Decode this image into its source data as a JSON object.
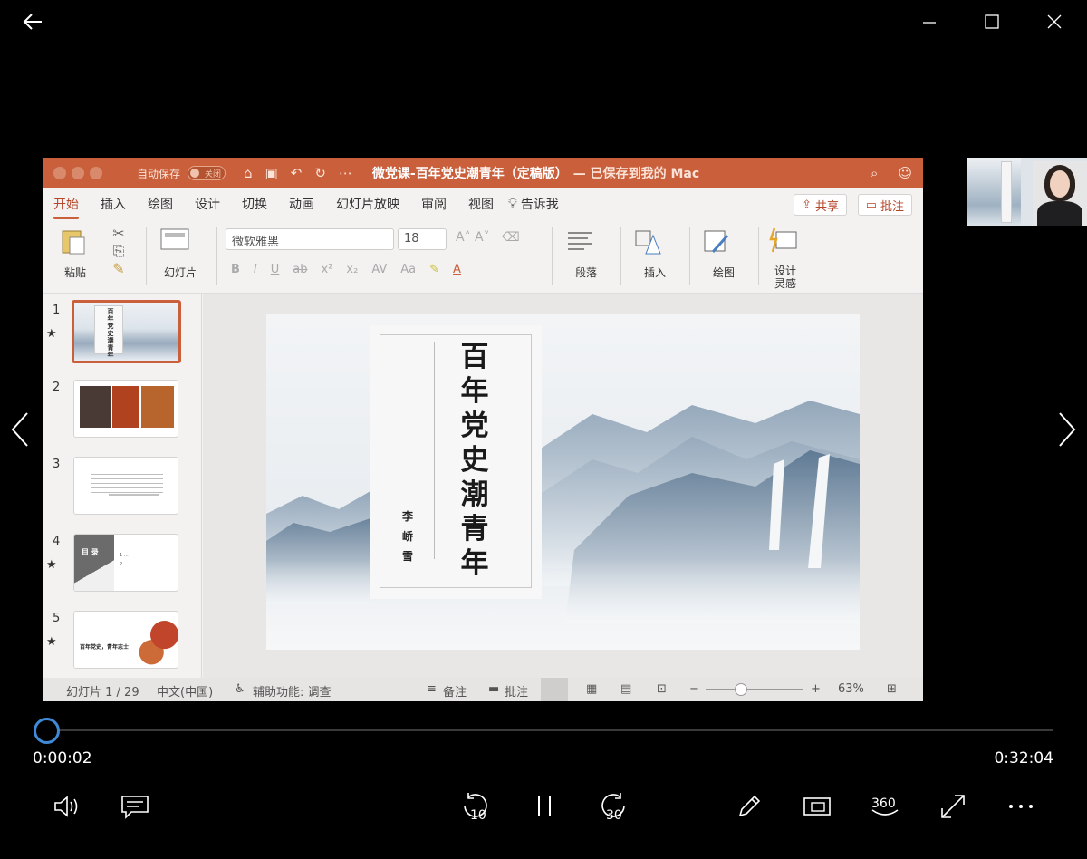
{
  "window": {
    "back_icon": "arrow-left-icon",
    "minimize_icon": "minimize-icon",
    "maximize_icon": "maximize-icon",
    "close_icon": "close-icon"
  },
  "ppt": {
    "autosave_label": "自动保存",
    "autosave_state": "关闭",
    "doc_title": "微党课-百年党史潮青年（定稿版）",
    "saved_note": "— 已保存到我的 Mac",
    "tabs": [
      "开始",
      "插入",
      "绘图",
      "设计",
      "切换",
      "动画",
      "幻灯片放映",
      "审阅",
      "视图"
    ],
    "tell_me": "告诉我",
    "share_label": "共享",
    "comment_label": "批注",
    "ribbon": {
      "paste": "粘贴",
      "slide": "幻灯片",
      "font_name": "微软雅黑",
      "font_size": "18",
      "paragraph": "段落",
      "insert": "插入",
      "draw": "绘图",
      "designer_1": "设计",
      "designer_2": "灵感",
      "fmt_buttons": [
        "B",
        "I",
        "U",
        "ab",
        "x²",
        "x₂",
        "AV",
        "Aa"
      ]
    },
    "thumb_numbers": [
      "1",
      "2",
      "3",
      "4",
      "5"
    ],
    "thumbs": {
      "t1_title": "百年党史潮青年",
      "t4_label": "目 录",
      "t4_item1": "1  …",
      "t4_item2": "2  …",
      "t5_title": "百年党史，青年志士"
    },
    "slide": {
      "title_chars": [
        "百",
        "年",
        "党",
        "史",
        "潮",
        "青",
        "年"
      ],
      "author_chars": [
        "李",
        "峤",
        "雪"
      ]
    },
    "status": {
      "slide_info": "幻灯片 1 / 29",
      "language": "中文(中国)",
      "accessibility": "辅助功能: 调查",
      "notes": "备注",
      "comments": "批注",
      "zoom": "63%",
      "zoom_level": 0.3
    }
  },
  "player": {
    "current_time": "0:00:02",
    "total_time": "0:32:04",
    "progress": 0.001,
    "skip_back": "10",
    "skip_forward": "30",
    "accent": "#3f8ad8"
  }
}
